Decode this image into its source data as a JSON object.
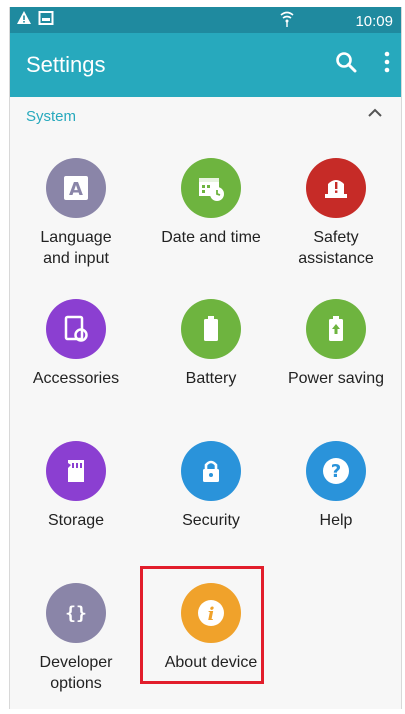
{
  "status_bar": {
    "time": "10:09",
    "icons": [
      "warning-icon",
      "image-icon",
      "wifi-icon"
    ]
  },
  "header": {
    "title": "Settings",
    "actions": [
      "search-icon",
      "more-vert-icon"
    ]
  },
  "section": {
    "title": "System",
    "expanded": true
  },
  "items": [
    {
      "label": "Language\nand input",
      "icon": "language-icon",
      "color": "#8a85a8"
    },
    {
      "label": "Date and time",
      "icon": "calendar-clock-icon",
      "color": "#6eb43f"
    },
    {
      "label": "Safety\nassistance",
      "icon": "safety-alert-icon",
      "color": "#c62b27"
    },
    {
      "label": "Accessories",
      "icon": "accessories-icon",
      "color": "#8b3fd1"
    },
    {
      "label": "Battery",
      "icon": "battery-icon",
      "color": "#6eb43f"
    },
    {
      "label": "Power saving",
      "icon": "power-saving-icon",
      "color": "#6eb43f"
    },
    {
      "label": "Storage",
      "icon": "storage-icon",
      "color": "#8b3fd1"
    },
    {
      "label": "Security",
      "icon": "lock-icon",
      "color": "#2a93da"
    },
    {
      "label": "Help",
      "icon": "help-icon",
      "color": "#2a93da"
    },
    {
      "label": "Developer\noptions",
      "icon": "developer-icon",
      "color": "#8a85a8"
    },
    {
      "label": "About device",
      "icon": "info-icon",
      "color": "#f0a22b"
    }
  ],
  "highlighted_item": "About device"
}
